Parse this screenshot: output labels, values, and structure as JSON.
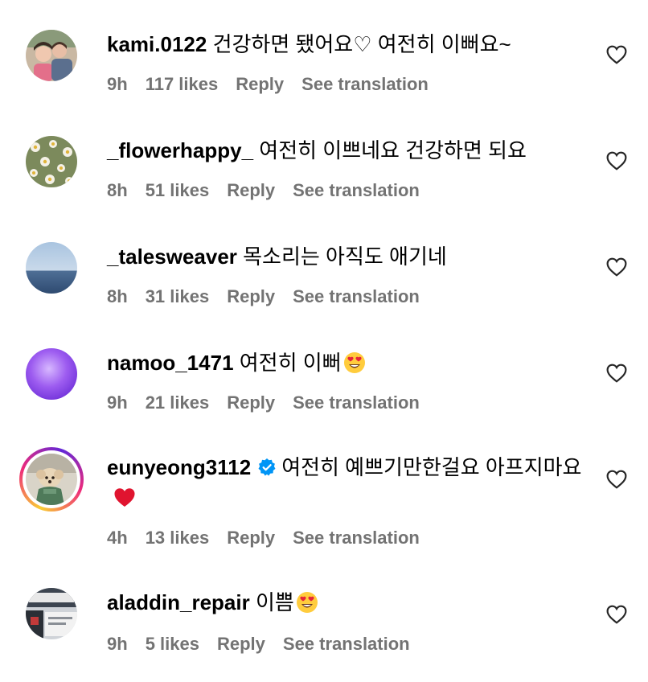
{
  "comments": [
    {
      "username": "kami.0122",
      "text": "건강하면 됐어요♡ 여전히 이뻐요~",
      "emoji": "",
      "time": "9h",
      "likes": "117 likes",
      "reply": "Reply",
      "translate": "See translation",
      "verified": false
    },
    {
      "username": "_flowerhappy_",
      "text": "여전히 이쁘네요 건강하면 되요",
      "emoji": "",
      "time": "8h",
      "likes": "51 likes",
      "reply": "Reply",
      "translate": "See translation",
      "verified": false
    },
    {
      "username": "_talesweaver",
      "text": "목소리는 아직도 애기네",
      "emoji": "",
      "time": "8h",
      "likes": "31 likes",
      "reply": "Reply",
      "translate": "See translation",
      "verified": false
    },
    {
      "username": "namoo_1471",
      "text": "여전히 이뻐",
      "emoji": "heart-eyes-emoji",
      "time": "9h",
      "likes": "21 likes",
      "reply": "Reply",
      "translate": "See translation",
      "verified": false
    },
    {
      "username": "eunyeong3112",
      "text": "여전히 예쁘기만한걸요 아프지마요",
      "emoji": "red-heart-emoji",
      "time": "4h",
      "likes": "13 likes",
      "reply": "Reply",
      "translate": "See translation",
      "verified": true
    },
    {
      "username": "aladdin_repair",
      "text": "이쁨",
      "emoji": "heart-eyes-emoji",
      "time": "9h",
      "likes": "5 likes",
      "reply": "Reply",
      "translate": "See translation",
      "verified": false
    }
  ],
  "colors": {
    "text": "#000000",
    "meta": "#737373",
    "verified": "#0095f6"
  },
  "icons": {
    "like": "heart-outline-icon",
    "verified": "verified-badge-icon"
  }
}
